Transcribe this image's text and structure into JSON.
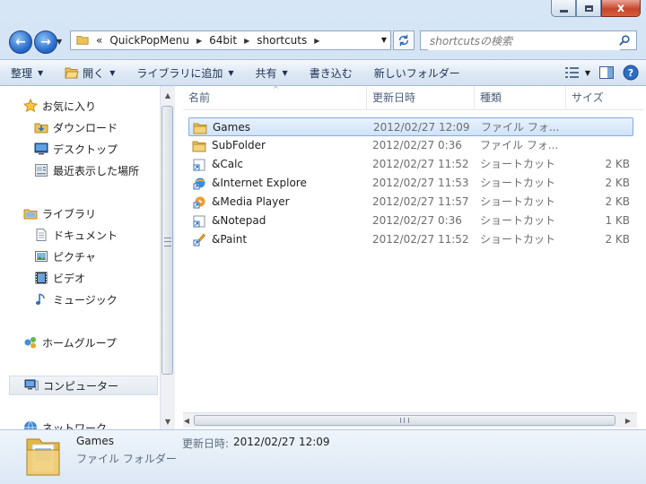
{
  "window": {
    "caption_buttons": [
      "minimize",
      "maximize",
      "close"
    ],
    "close_glyph": "x"
  },
  "nav": {
    "back_glyph": "←",
    "forward_glyph": "→",
    "overflow_glyph": "«",
    "breadcrumb": [
      "QuickPopMenu",
      "64bit",
      "shortcuts"
    ],
    "breadcrumb_sep": "▶",
    "dropdown_glyph": "▼",
    "search_placeholder": "shortcutsの検索"
  },
  "toolbar": {
    "organize": "整理",
    "open": "開く",
    "add_to_library": "ライブラリに追加",
    "share": "共有",
    "burn": "書き込む",
    "new_folder": "新しいフォルダー",
    "dd": "▼"
  },
  "sidebar": {
    "favorites": {
      "label": "お気に入り",
      "items": [
        "ダウンロード",
        "デスクトップ",
        "最近表示した場所"
      ]
    },
    "libraries": {
      "label": "ライブラリ",
      "items": [
        "ドキュメント",
        "ピクチャ",
        "ビデオ",
        "ミュージック"
      ]
    },
    "homegroup": "ホームグループ",
    "computer": "コンピューター",
    "network": "ネットワーク",
    "scroll_up": "▲",
    "scroll_down": "▼"
  },
  "columns": {
    "name": "名前",
    "date": "更新日時",
    "type": "種類",
    "size": "サイズ",
    "sort_glyph": "^"
  },
  "files": [
    {
      "name": "Games",
      "date": "2012/02/27 12:09",
      "type": "ファイル フォ...",
      "size": "",
      "icon": "folder-icon",
      "selected": true
    },
    {
      "name": "SubFolder",
      "date": "2012/02/27 0:36",
      "type": "ファイル フォ...",
      "size": "",
      "icon": "folder-icon",
      "selected": false
    },
    {
      "name": "&Calc",
      "date": "2012/02/27 11:52",
      "type": "ショートカット",
      "size": "2 KB",
      "icon": "shortcut-icon",
      "selected": false
    },
    {
      "name": "&Internet Explore",
      "date": "2012/02/27 11:53",
      "type": "ショートカット",
      "size": "2 KB",
      "icon": "ie-shortcut-icon",
      "selected": false
    },
    {
      "name": "&Media Player",
      "date": "2012/02/27 11:57",
      "type": "ショートカット",
      "size": "2 KB",
      "icon": "media-player-shortcut-icon",
      "selected": false
    },
    {
      "name": "&Notepad",
      "date": "2012/02/27 0:36",
      "type": "ショートカット",
      "size": "1 KB",
      "icon": "shortcut-icon",
      "selected": false
    },
    {
      "name": "&Paint",
      "date": "2012/02/27 11:52",
      "type": "ショートカット",
      "size": "2 KB",
      "icon": "paint-shortcut-icon",
      "selected": false
    }
  ],
  "hscroll": {
    "left": "◀",
    "right": "▶"
  },
  "details": {
    "name": "Games",
    "type": "ファイル フォルダー",
    "modified_label": "更新日時:",
    "modified_value": "2012/02/27 12:09"
  },
  "colors": {
    "accent": "#2a6fcf",
    "selection_bg": "#cfe3fa",
    "selection_border": "#84acdd",
    "folder": "#e9c35a"
  }
}
